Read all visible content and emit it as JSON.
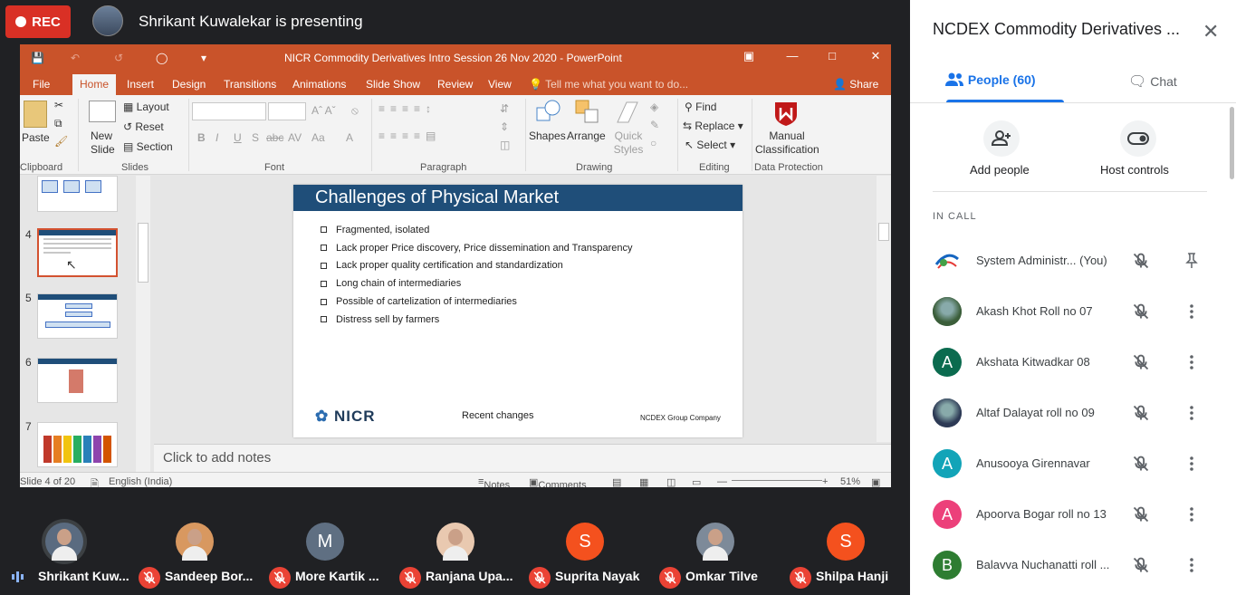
{
  "meet": {
    "rec_label": "REC",
    "presenter_text": "Shrikant Kuwalekar is presenting"
  },
  "ppt": {
    "window_title": "NICR Commodity Derivatives Intro Session 26 Nov 2020 - PowerPoint",
    "tabs": [
      "File",
      "Home",
      "Insert",
      "Design",
      "Transitions",
      "Animations",
      "Slide Show",
      "Review",
      "View"
    ],
    "tell_me": "Tell me what you want to do...",
    "share": "Share",
    "ribbon": {
      "paste": "Paste",
      "new_slide": "New Slide",
      "layout": "Layout",
      "reset": "Reset",
      "section": "Section",
      "shapes": "Shapes",
      "arrange": "Arrange",
      "quick_styles": "Quick Styles",
      "find": "Find",
      "replace": "Replace",
      "select": "Select",
      "manual_classification": "Manual Classification",
      "groups": {
        "clipboard": "Clipboard",
        "slides": "Slides",
        "font": "Font",
        "paragraph": "Paragraph",
        "drawing": "Drawing",
        "editing": "Editing",
        "data_protection": "Data Protection"
      }
    },
    "thumb_numbers": [
      "4",
      "5",
      "6",
      "7"
    ],
    "slide": {
      "title": "Challenges of Physical Market",
      "bullets": [
        "Fragmented, isolated",
        "Lack proper Price discovery,  Price dissemination and Transparency",
        "Lack proper quality certification and standardization",
        "Long chain of intermediaries",
        "Possible of cartelization of intermediaries",
        "Distress sell by farmers"
      ],
      "logo": "NICR",
      "footer_mid": "Recent changes",
      "footer_right": "NCDEX Group Company"
    },
    "notes_placeholder": "Click to add notes",
    "status": {
      "slide_of": "Slide 4 of 20",
      "language": "English (India)",
      "notes": "Notes",
      "comments": "Comments",
      "zoom": "51%"
    }
  },
  "participants_strip": [
    {
      "name": "Shrikant Kuw...",
      "type": "photo",
      "color": "#5a6b80",
      "muted": false
    },
    {
      "name": "Sandeep Bor...",
      "type": "photo",
      "color": "#d89860",
      "muted": true
    },
    {
      "name": "More Kartik ...",
      "type": "letter",
      "letter": "M",
      "color": "#5f6f82",
      "muted": true
    },
    {
      "name": "Ranjana Upa...",
      "type": "photo",
      "color": "#e9c9b0",
      "muted": true
    },
    {
      "name": "Suprita Nayak",
      "type": "letter",
      "letter": "S",
      "color": "#f4511e",
      "muted": true
    },
    {
      "name": "Omkar Tilve",
      "type": "photo",
      "color": "#7d8a99",
      "muted": true
    },
    {
      "name": "Shilpa Hanji",
      "type": "letter",
      "letter": "S",
      "color": "#f4511e",
      "muted": true
    }
  ],
  "side_panel": {
    "title": "NCDEX Commodity Derivatives ...",
    "tab_people": "People (60)",
    "tab_chat": "Chat",
    "add_people": "Add people",
    "host_controls": "Host controls",
    "in_call": "IN CALL",
    "people": [
      {
        "name": "System Administr...",
        "suffix": "(You)",
        "avatar": "logo",
        "color": "#ffffff"
      },
      {
        "name": "Akash Khot Roll no 07",
        "avatar": "photo",
        "color": "#3b5e3a"
      },
      {
        "name": "Akshata Kitwadkar 08",
        "avatar": "letter",
        "letter": "A",
        "color": "#0b6b4f"
      },
      {
        "name": "Altaf Dalayat roll no 09",
        "avatar": "photo",
        "color": "#2d3a55"
      },
      {
        "name": "Anusooya Girennavar",
        "avatar": "letter",
        "letter": "A",
        "color": "#12a4b8"
      },
      {
        "name": "Apoorva Bogar roll no 13",
        "avatar": "letter",
        "letter": "A",
        "color": "#ec407a"
      },
      {
        "name": "Balavva Nuchanatti roll ...",
        "avatar": "letter",
        "letter": "B",
        "color": "#2e7d32"
      }
    ]
  }
}
